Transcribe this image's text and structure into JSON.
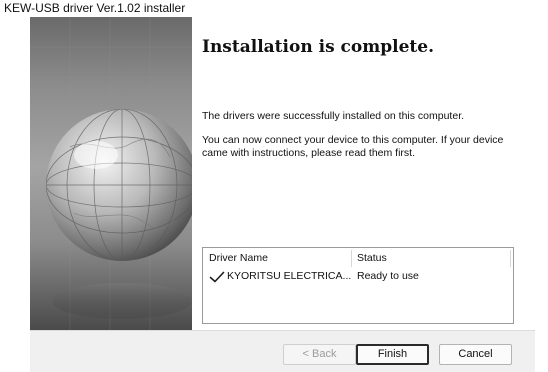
{
  "window": {
    "title": "KEW-USB driver Ver.1.02 installer"
  },
  "content": {
    "heading": "Installation is complete.",
    "paragraph1": "The drivers were successfully installed on this computer.",
    "paragraph2": "You can now connect your device to this computer. If your device came with instructions, please read them first."
  },
  "driver_list": {
    "columns": [
      "Driver Name",
      "Status"
    ],
    "rows": [
      {
        "icon": "checkmark-icon",
        "name": "KYORITSU ELECTRICA...",
        "status": "Ready to use"
      }
    ]
  },
  "buttons": {
    "back": "< Back",
    "finish": "Finish",
    "cancel": "Cancel"
  },
  "icons": {
    "side_graphic": "globe-icon",
    "status": "checkmark-icon"
  },
  "colors": {
    "side_panel": "#8c8c8c",
    "button_bar": "#f0f0f0",
    "default_button_border": "#2a2a2a"
  }
}
